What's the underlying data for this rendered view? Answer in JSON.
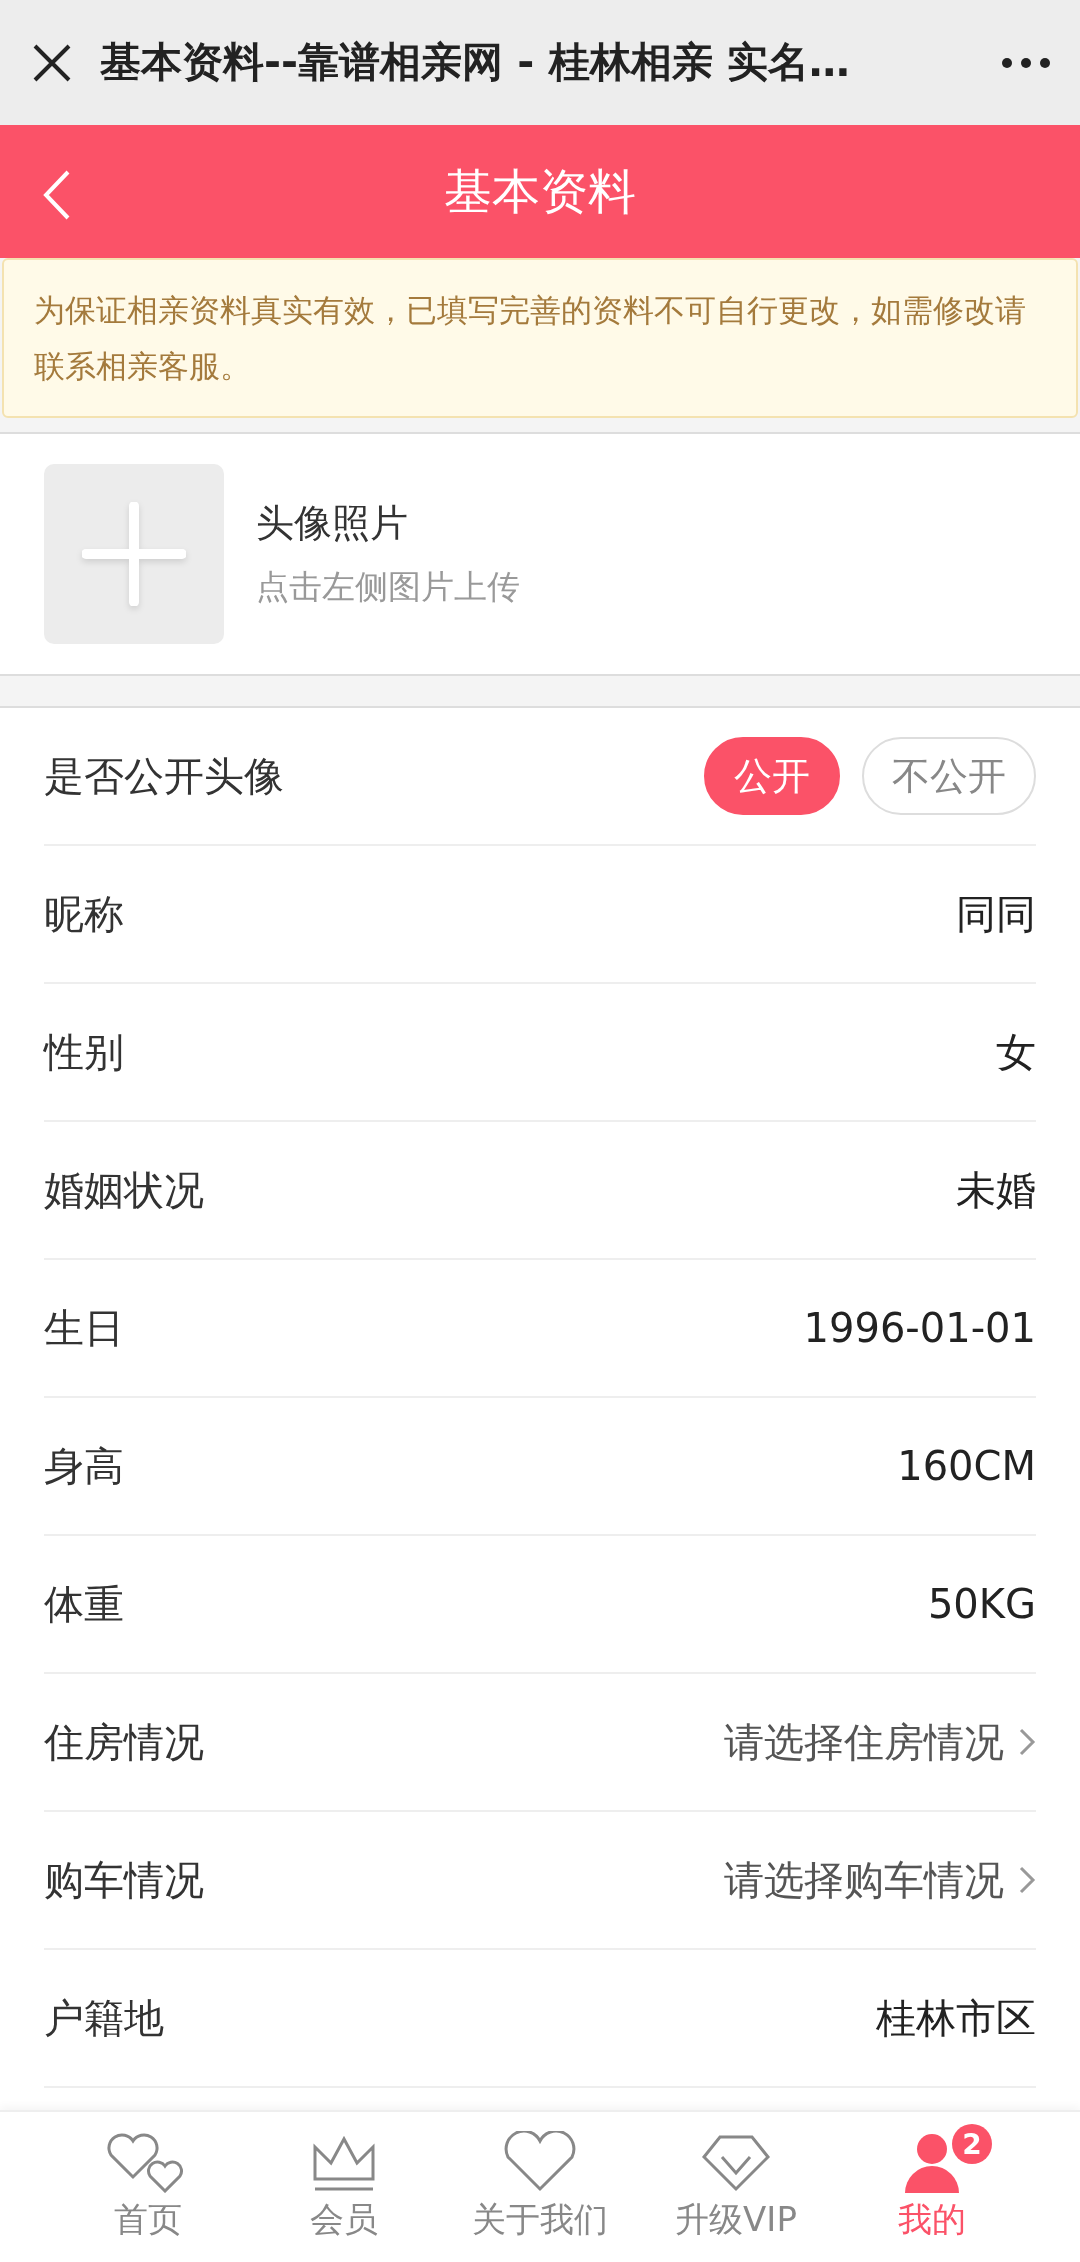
{
  "window": {
    "title": "基本资料--靠谱相亲网 - 桂林相亲 实名…"
  },
  "header": {
    "title": "基本资料"
  },
  "notice": "为保证相亲资料真实有效，已填写完善的资料不可自行更改，如需修改请联系相亲客服。",
  "avatar": {
    "title": "头像照片",
    "hint": "点击左侧图片上传"
  },
  "rows": [
    {
      "kind": "toggle",
      "label": "是否公开头像",
      "options": [
        {
          "label": "公开",
          "selected": true
        },
        {
          "label": "不公开",
          "selected": false
        }
      ]
    },
    {
      "kind": "value",
      "label": "昵称",
      "value": "同同"
    },
    {
      "kind": "value",
      "label": "性别",
      "value": "女"
    },
    {
      "kind": "value",
      "label": "婚姻状况",
      "value": "未婚"
    },
    {
      "kind": "value",
      "label": "生日",
      "value": "1996-01-01"
    },
    {
      "kind": "value",
      "label": "身高",
      "value": "160CM"
    },
    {
      "kind": "value",
      "label": "体重",
      "value": "50KG"
    },
    {
      "kind": "select",
      "label": "住房情况",
      "placeholder": "请选择住房情况"
    },
    {
      "kind": "select",
      "label": "购车情况",
      "placeholder": "请选择购车情况"
    },
    {
      "kind": "value",
      "label": "户籍地",
      "value": "桂林市区"
    }
  ],
  "nav": [
    {
      "kind": "hearts",
      "label": "首页",
      "selected": false
    },
    {
      "kind": "crown",
      "label": "会员",
      "selected": false
    },
    {
      "kind": "heart",
      "label": "关于我们",
      "selected": false
    },
    {
      "kind": "diamond",
      "label": "升级VIP",
      "selected": false
    },
    {
      "kind": "person",
      "label": "我的",
      "selected": true,
      "badge": "2"
    }
  ]
}
